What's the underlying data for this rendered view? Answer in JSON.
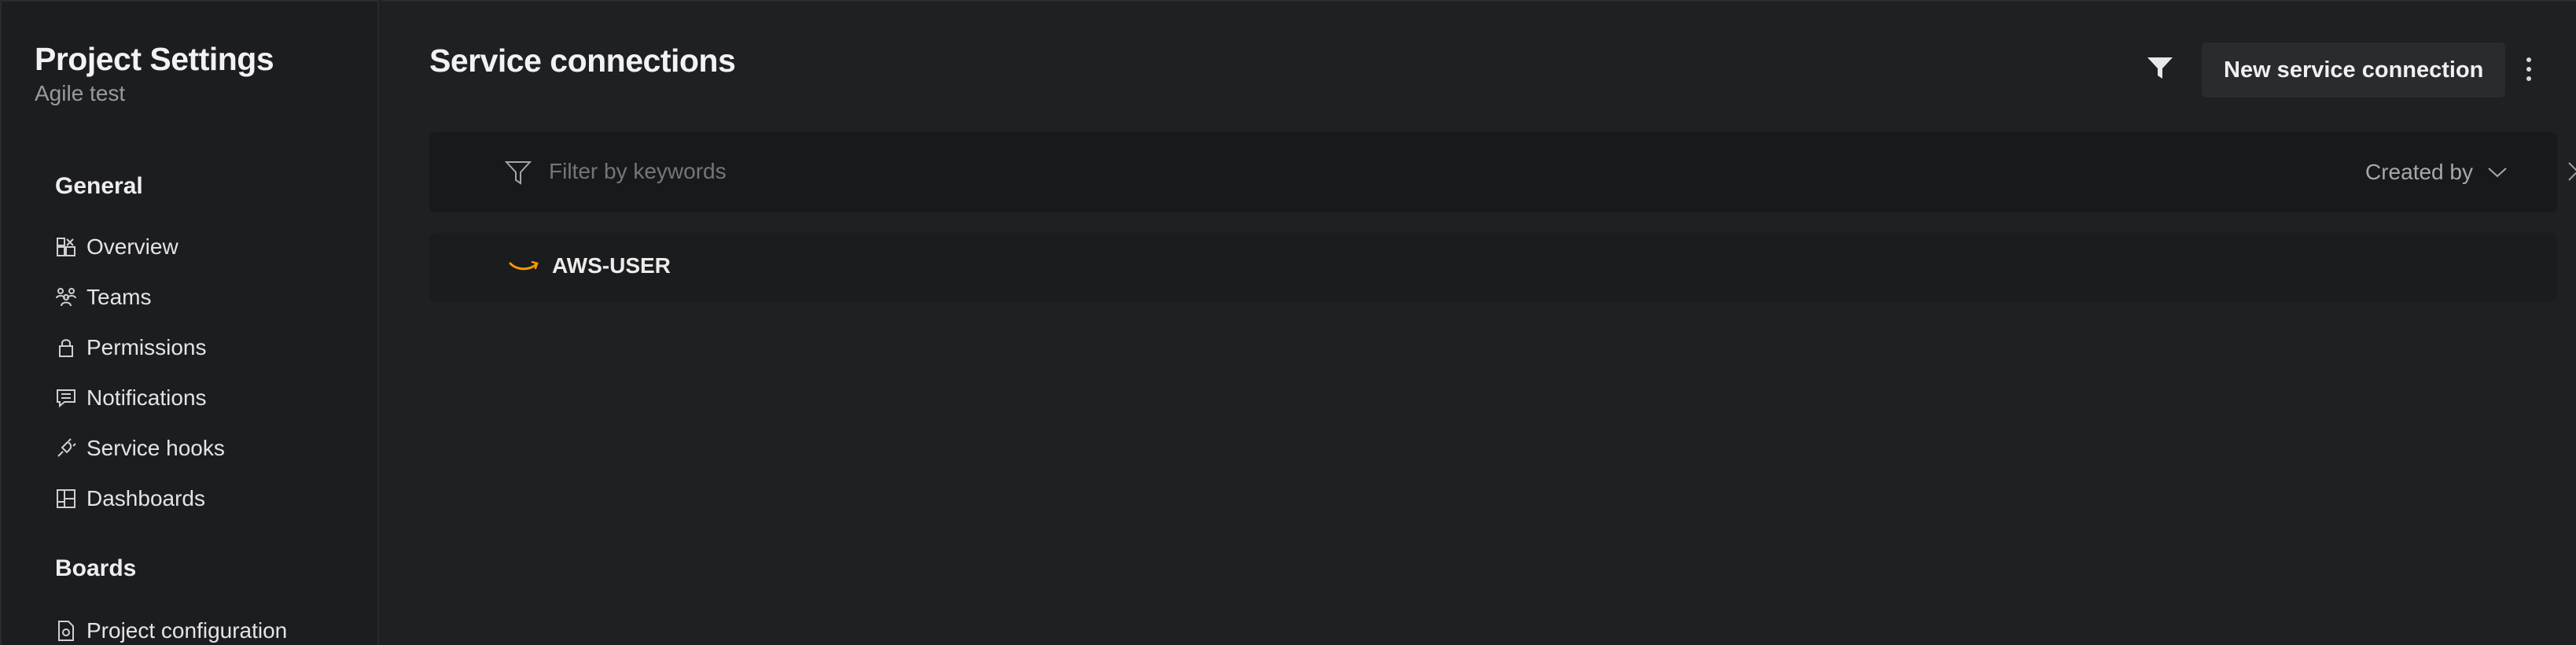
{
  "sidebar": {
    "title": "Project Settings",
    "subtitle": "Agile test",
    "sections": [
      {
        "label": "General",
        "items": [
          {
            "label": "Overview",
            "icon": "overview-icon"
          },
          {
            "label": "Teams",
            "icon": "teams-icon"
          },
          {
            "label": "Permissions",
            "icon": "lock-icon"
          },
          {
            "label": "Notifications",
            "icon": "chat-icon"
          },
          {
            "label": "Service hooks",
            "icon": "plug-icon"
          },
          {
            "label": "Dashboards",
            "icon": "dashboard-icon"
          }
        ]
      },
      {
        "label": "Boards",
        "items": [
          {
            "label": "Project configuration",
            "icon": "file-settings-icon"
          }
        ]
      }
    ]
  },
  "main": {
    "title": "Service connections",
    "new_button_label": "New service connection",
    "filter": {
      "placeholder": "Filter by keywords",
      "created_by_label": "Created by"
    },
    "connections": [
      {
        "name": "AWS-USER",
        "icon": "aws-icon"
      }
    ]
  },
  "colors": {
    "background": "#1f2023",
    "sidebar_background": "#1c1d20",
    "filter_bar_background": "#18191b",
    "button_background": "#2a2b2e",
    "aws_accent": "#ff9900"
  }
}
